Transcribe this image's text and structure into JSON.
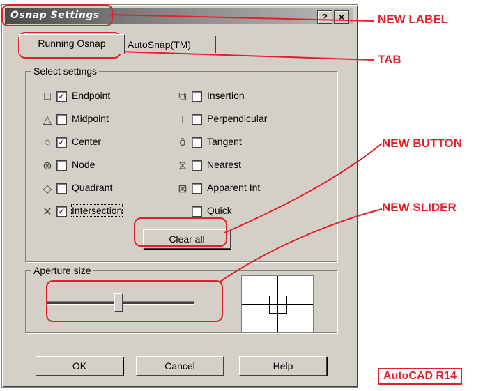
{
  "dialog": {
    "title": "Osnap Settings",
    "help_btn": "?",
    "close_btn": "×"
  },
  "tabs": [
    {
      "label": "Running Osnap"
    },
    {
      "label": "AutoSnap(TM)"
    }
  ],
  "select_settings": {
    "legend": "Select settings",
    "left": [
      {
        "label": "Endpoint",
        "checked": true,
        "check": "✓",
        "symbol": "□"
      },
      {
        "label": "Midpoint",
        "checked": false,
        "check": "",
        "symbol": "△"
      },
      {
        "label": "Center",
        "checked": true,
        "check": "✓",
        "symbol": "○"
      },
      {
        "label": "Node",
        "checked": false,
        "check": "",
        "symbol": "⊗"
      },
      {
        "label": "Quadrant",
        "checked": false,
        "check": "",
        "symbol": "◇"
      },
      {
        "label": "Intersection",
        "checked": true,
        "check": "✓",
        "symbol": "✕"
      }
    ],
    "right": [
      {
        "label": "Insertion",
        "checked": false,
        "check": "",
        "symbol": "⧉"
      },
      {
        "label": "Perpendicular",
        "checked": false,
        "check": "",
        "symbol": "⊥"
      },
      {
        "label": "Tangent",
        "checked": false,
        "check": "",
        "symbol": "ō"
      },
      {
        "label": "Nearest",
        "checked": false,
        "check": "",
        "symbol": "⧖"
      },
      {
        "label": "Apparent Int",
        "checked": false,
        "check": "",
        "symbol": "⊠"
      },
      {
        "label": "Quick",
        "checked": false,
        "check": "",
        "symbol": ""
      }
    ],
    "clear_all": "Clear all"
  },
  "aperture": {
    "legend": "Aperture size",
    "slider_value_fraction": 0.48
  },
  "buttons": {
    "ok": "OK",
    "cancel": "Cancel",
    "help": "Help"
  },
  "annotations": {
    "new_label": "NEW LABEL",
    "tab": "TAB",
    "new_button": "NEW BUTTON",
    "new_slider": "NEW SLIDER",
    "version": "AutoCAD R14",
    "color": "#e0202a"
  }
}
